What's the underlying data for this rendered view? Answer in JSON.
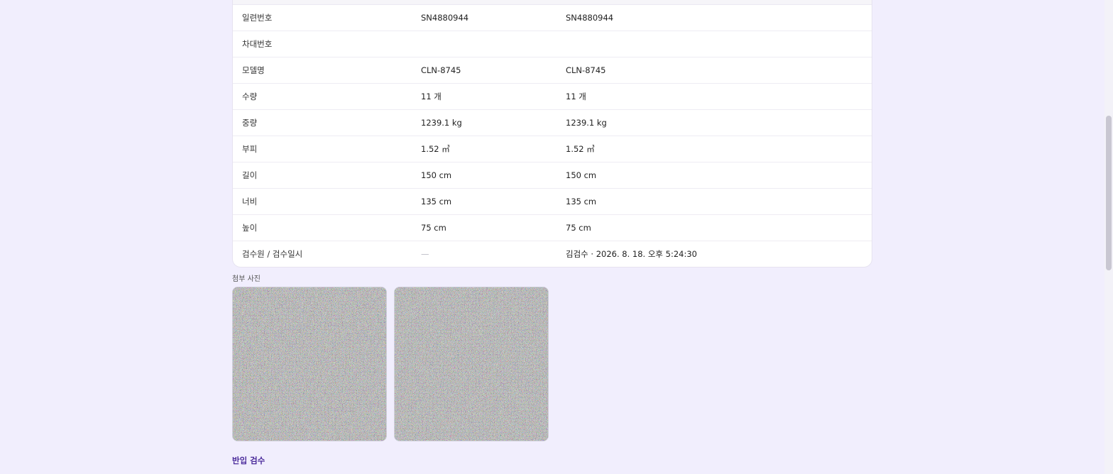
{
  "table": {
    "rows": [
      {
        "label": "일련번호",
        "a": "SN4880944",
        "b": "SN4880944"
      },
      {
        "label": "차대번호",
        "a": "",
        "b": ""
      },
      {
        "label": "모델명",
        "a": "CLN-8745",
        "b": "CLN-8745"
      },
      {
        "label": "수량",
        "a": "11 개",
        "b": "11 개"
      },
      {
        "label": "중량",
        "a": "1239.1 kg",
        "b": "1239.1 kg"
      },
      {
        "label": "부피",
        "a": "1.52 ㎥",
        "b": "1.52 ㎥"
      },
      {
        "label": "길이",
        "a": "150 cm",
        "b": "150 cm"
      },
      {
        "label": "너비",
        "a": "135 cm",
        "b": "135 cm"
      },
      {
        "label": "높이",
        "a": "75 cm",
        "b": "75 cm"
      },
      {
        "label": "검수원 / 검수일시",
        "a": "—",
        "b": "김검수 · 2026. 8. 18. 오후 5:24:30"
      }
    ]
  },
  "photos": {
    "title": "첨부 사진",
    "count": 2
  },
  "section": {
    "title": "반입 검수"
  },
  "colors": {
    "background": "#f1eefd",
    "accent": "#4a2a9b"
  }
}
